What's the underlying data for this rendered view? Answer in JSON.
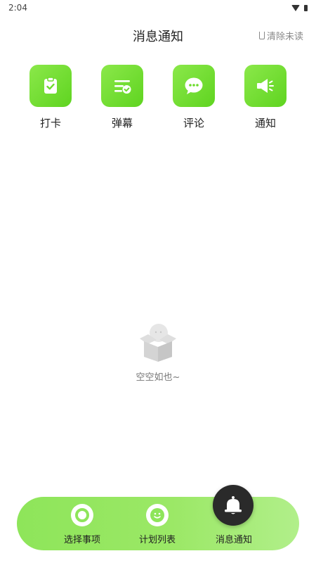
{
  "status_bar": {
    "time": "2:04",
    "icons": [
      "wifi-icon",
      "battery-icon"
    ]
  },
  "header": {
    "title": "消息通知",
    "clear_unread_label": "清除未读",
    "clear_icon": "broom-icon"
  },
  "categories": [
    {
      "label": "打卡",
      "icon": "clipboard-check-icon"
    },
    {
      "label": "弹幕",
      "icon": "list-check-icon"
    },
    {
      "label": "评论",
      "icon": "chat-bubble-icon"
    },
    {
      "label": "通知",
      "icon": "megaphone-icon"
    }
  ],
  "empty_state": {
    "text": "空空如也~",
    "icon": "empty-box-icon"
  },
  "bottom_nav": {
    "items": [
      {
        "label": "选择事项",
        "icon": "ring-icon"
      },
      {
        "label": "计划列表",
        "icon": "smile-icon"
      },
      {
        "label": "消息通知",
        "icon": "bell-icon",
        "active": true
      }
    ]
  },
  "colors": {
    "accent_green": "#6cdb2c",
    "nav_gradient_start": "#8ee55a",
    "nav_gradient_end": "#b1ef8a",
    "active_dark": "#2a2a2a"
  }
}
